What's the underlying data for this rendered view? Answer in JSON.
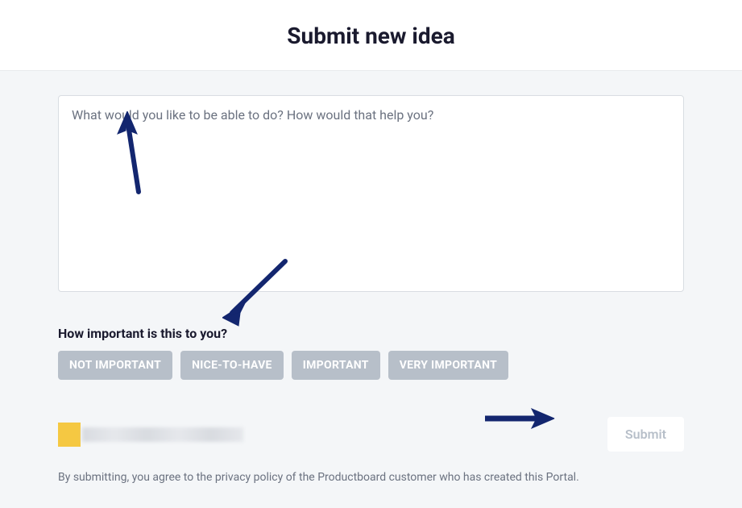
{
  "header": {
    "title": "Submit new idea"
  },
  "form": {
    "idea_placeholder": "What would you like to be able to do? How would that help you?",
    "importance_label": "How important is this to you?",
    "importance_options": {
      "not_important": "NOT IMPORTANT",
      "nice_to_have": "NICE-TO-HAVE",
      "important": "IMPORTANT",
      "very_important": "VERY IMPORTANT"
    },
    "submit_label": "Submit",
    "disclaimer": "By submitting, you agree to the privacy policy of the Productboard customer who has created this Portal."
  }
}
